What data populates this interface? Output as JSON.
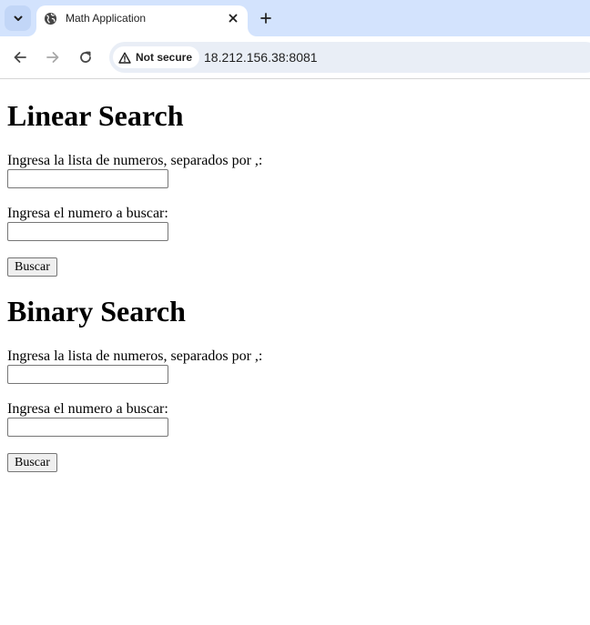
{
  "browser": {
    "tab_title": "Math Application",
    "security_label": "Not secure",
    "url": "18.212.156.38:8081"
  },
  "linear": {
    "heading": "Linear Search",
    "list_label": "Ingresa la lista de numeros, separados por ,:",
    "list_value": "",
    "number_label": "Ingresa el numero a buscar:",
    "number_value": "",
    "button_label": "Buscar"
  },
  "binary": {
    "heading": "Binary Search",
    "list_label": "Ingresa la lista de numeros, separados por ,:",
    "list_value": "",
    "number_label": "Ingresa el numero a buscar:",
    "number_value": "",
    "button_label": "Buscar"
  },
  "icons": {
    "tab_search": "chevron-down-icon",
    "favicon": "globe-icon",
    "tab_close": "close-icon",
    "new_tab": "plus-icon",
    "back": "arrow-left-icon",
    "forward": "arrow-right-icon",
    "reload": "reload-icon",
    "security": "warning-icon"
  }
}
